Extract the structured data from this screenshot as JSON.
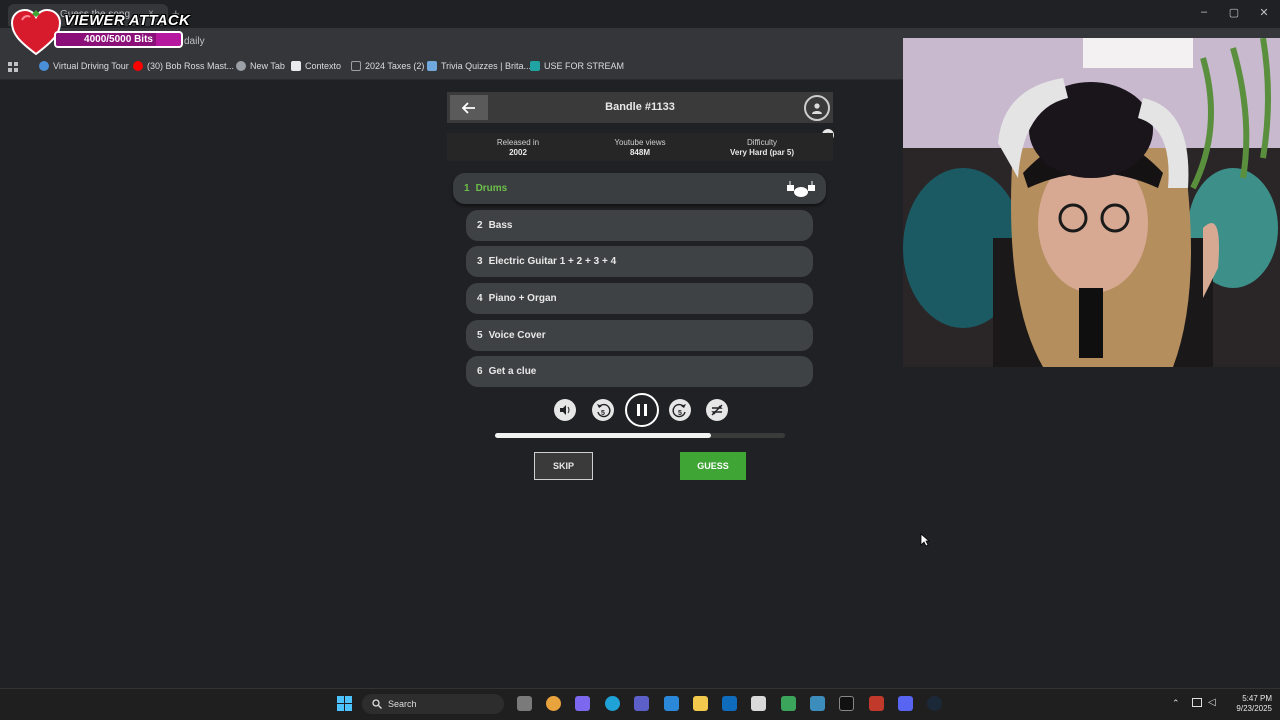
{
  "browser": {
    "tab_title": "Guess the song",
    "tab_close": "×",
    "new_tab": "+",
    "window_controls": {
      "minimize": "–",
      "maximize": "▢",
      "close": "✕"
    },
    "address_partial": "daily",
    "bookmarks": [
      {
        "label": "Virtual Driving Tour",
        "icon": "globe-icon",
        "color": "#4a90d9"
      },
      {
        "label": "(30) Bob Ross Mast...",
        "icon": "youtube-icon",
        "color": "#ff0000"
      },
      {
        "label": "New Tab",
        "icon": "chrome-icon",
        "color": "#9aa0a6"
      },
      {
        "label": "Contexto",
        "icon": "contexto-icon",
        "color": "#e8eaed"
      },
      {
        "label": "2024 Taxes (2)",
        "icon": "folder-icon",
        "color": "#9aa0a6"
      },
      {
        "label": "Trivia Quizzes | Brita...",
        "icon": "trivia-icon",
        "color": "#6fa8dc"
      },
      {
        "label": "USE FOR STREAM",
        "icon": "stream-icon",
        "color": "#1fa3a3"
      }
    ]
  },
  "overlay": {
    "title": "VIEWER ATTACK",
    "bits_text": "4000/5000 Bits",
    "bits_progress": 0.8
  },
  "game": {
    "title": "Bandle #1133",
    "info": [
      {
        "label": "Released in",
        "value": "2002"
      },
      {
        "label": "Youtube views",
        "value": "848M"
      },
      {
        "label": "Difficulty",
        "value": "Very Hard (par 5)"
      }
    ],
    "clues": [
      {
        "num": "1",
        "label": "Drums"
      },
      {
        "num": "2",
        "label": "Bass"
      },
      {
        "num": "3",
        "label": "Electric Guitar 1 + 2 + 3 + 4"
      },
      {
        "num": "4",
        "label": "Piano + Organ"
      },
      {
        "num": "5",
        "label": "Voice Cover"
      },
      {
        "num": "6",
        "label": "Get a clue"
      }
    ],
    "rewind_label": "5",
    "forward_label": "5",
    "progress": 0.745,
    "skip_label": "SKIP",
    "guess_label": "GUESS",
    "colors": {
      "active_clue": "#6cc04a",
      "guess": "#3fa535"
    }
  },
  "taskbar": {
    "search_label": "Search",
    "time": "5:47 PM",
    "date": "9/23/2025"
  }
}
